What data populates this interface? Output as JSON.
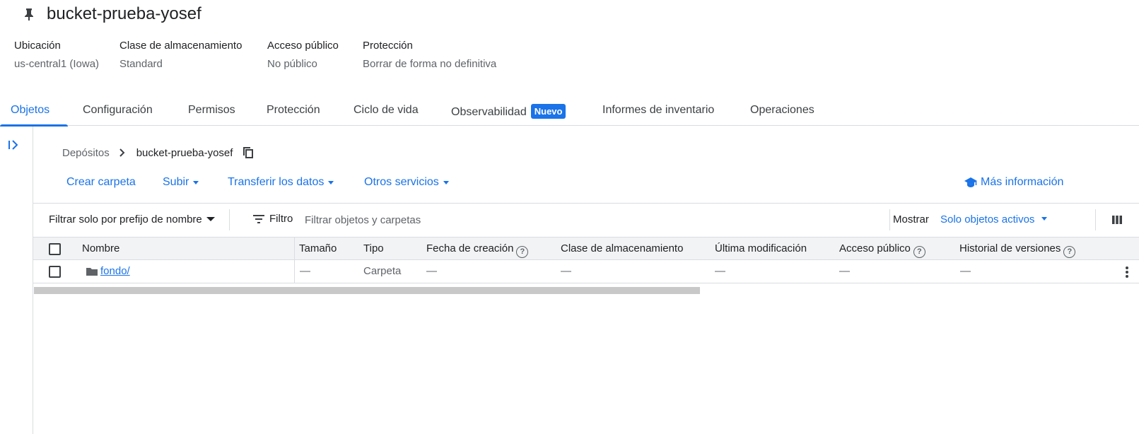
{
  "bucket": {
    "title": "bucket-prueba-yosef"
  },
  "meta": [
    {
      "label": "Ubicación",
      "value": "us-central1 (Iowa)"
    },
    {
      "label": "Clase de almacenamiento",
      "value": "Standard"
    },
    {
      "label": "Acceso público",
      "value": "No público"
    },
    {
      "label": "Protección",
      "value": "Borrar de forma no definitiva"
    }
  ],
  "tabs": {
    "objetos": "Objetos",
    "configuracion": "Configuración",
    "permisos": "Permisos",
    "proteccion": "Protección",
    "ciclo": "Ciclo de vida",
    "observabilidad": "Observabilidad",
    "observabilidad_badge": "Nuevo",
    "informes": "Informes de inventario",
    "operaciones": "Operaciones",
    "active": "objetos"
  },
  "breadcrumb": {
    "root": "Depósitos",
    "current": "bucket-prueba-yosef"
  },
  "actions": {
    "crear_carpeta": "Crear carpeta",
    "subir": "Subir",
    "transferir": "Transferir los datos",
    "otros": "Otros servicios",
    "mas_info": "Más información"
  },
  "filter": {
    "prefix_label": "Filtrar solo por prefijo de nombre",
    "filter_label": "Filtro",
    "placeholder": "Filtrar objetos y carpetas",
    "mostrar_label": "Mostrar",
    "mostrar_value": "Solo objetos activos"
  },
  "table": {
    "columns": {
      "nombre": "Nombre",
      "tamano": "Tamaño",
      "tipo": "Tipo",
      "fecha": "Fecha de creación",
      "clase": "Clase de almacenamiento",
      "modificacion": "Última modificación",
      "acceso": "Acceso público",
      "historial": "Historial de versiones"
    },
    "rows": [
      {
        "nombre": "fondo/",
        "tamano": "—",
        "tipo": "Carpeta",
        "fecha": "—",
        "clase": "—",
        "modificacion": "—",
        "acceso": "—",
        "historial": "—"
      }
    ]
  },
  "colors": {
    "accent": "#1a73e8",
    "text": "#202124",
    "muted": "#5f6368",
    "border": "#dadce0",
    "header_bg": "#f1f3f4"
  },
  "icons": [
    "pin-icon",
    "expand-panel-icon",
    "chevron-right-icon",
    "copy-icon",
    "school-icon",
    "filter-icon",
    "column-display-icon",
    "help-icon",
    "folder-icon",
    "more-vert-icon"
  ]
}
